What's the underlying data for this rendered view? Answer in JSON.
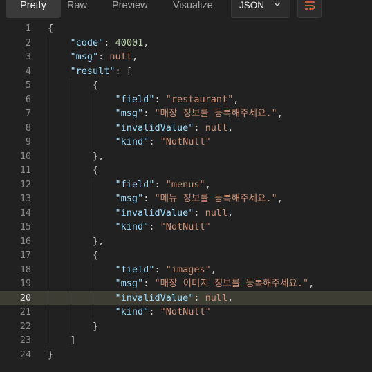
{
  "tabs": [
    {
      "label": "Pretty"
    },
    {
      "label": "Raw"
    },
    {
      "label": "Preview"
    },
    {
      "label": "Visualize"
    }
  ],
  "format_select": {
    "value": "JSON"
  },
  "wrap_button": {
    "icon": "wrap-lines-icon"
  },
  "highlighted_line": 20,
  "lines": [
    {
      "n": "1",
      "indent": 0,
      "tokens": [
        [
          "p",
          "{"
        ]
      ]
    },
    {
      "n": "2",
      "indent": 1,
      "tokens": [
        [
          "k",
          "\"code\""
        ],
        [
          "p",
          ": "
        ],
        [
          "n",
          "40001"
        ],
        [
          "p",
          ","
        ]
      ]
    },
    {
      "n": "3",
      "indent": 1,
      "tokens": [
        [
          "k",
          "\"msg\""
        ],
        [
          "p",
          ": "
        ],
        [
          "nl",
          "null"
        ],
        [
          "p",
          ","
        ]
      ]
    },
    {
      "n": "4",
      "indent": 1,
      "tokens": [
        [
          "k",
          "\"result\""
        ],
        [
          "p",
          ": ["
        ]
      ]
    },
    {
      "n": "5",
      "indent": 2,
      "tokens": [
        [
          "p",
          "{"
        ]
      ]
    },
    {
      "n": "6",
      "indent": 3,
      "tokens": [
        [
          "k",
          "\"field\""
        ],
        [
          "p",
          ": "
        ],
        [
          "s",
          "\"restaurant\""
        ],
        [
          "p",
          ","
        ]
      ]
    },
    {
      "n": "7",
      "indent": 3,
      "tokens": [
        [
          "k",
          "\"msg\""
        ],
        [
          "p",
          ": "
        ],
        [
          "s",
          "\"매장 정보를 등록해주세요.\""
        ],
        [
          "p",
          ","
        ]
      ]
    },
    {
      "n": "8",
      "indent": 3,
      "tokens": [
        [
          "k",
          "\"invalidValue\""
        ],
        [
          "p",
          ": "
        ],
        [
          "nl",
          "null"
        ],
        [
          "p",
          ","
        ]
      ]
    },
    {
      "n": "9",
      "indent": 3,
      "tokens": [
        [
          "k",
          "\"kind\""
        ],
        [
          "p",
          ": "
        ],
        [
          "s",
          "\"NotNull\""
        ]
      ]
    },
    {
      "n": "10",
      "indent": 2,
      "tokens": [
        [
          "p",
          "},"
        ]
      ]
    },
    {
      "n": "11",
      "indent": 2,
      "tokens": [
        [
          "p",
          "{"
        ]
      ]
    },
    {
      "n": "12",
      "indent": 3,
      "tokens": [
        [
          "k",
          "\"field\""
        ],
        [
          "p",
          ": "
        ],
        [
          "s",
          "\"menus\""
        ],
        [
          "p",
          ","
        ]
      ]
    },
    {
      "n": "13",
      "indent": 3,
      "tokens": [
        [
          "k",
          "\"msg\""
        ],
        [
          "p",
          ": "
        ],
        [
          "s",
          "\"메뉴 정보를 등록해주세요.\""
        ],
        [
          "p",
          ","
        ]
      ]
    },
    {
      "n": "14",
      "indent": 3,
      "tokens": [
        [
          "k",
          "\"invalidValue\""
        ],
        [
          "p",
          ": "
        ],
        [
          "nl",
          "null"
        ],
        [
          "p",
          ","
        ]
      ]
    },
    {
      "n": "15",
      "indent": 3,
      "tokens": [
        [
          "k",
          "\"kind\""
        ],
        [
          "p",
          ": "
        ],
        [
          "s",
          "\"NotNull\""
        ]
      ]
    },
    {
      "n": "16",
      "indent": 2,
      "tokens": [
        [
          "p",
          "},"
        ]
      ]
    },
    {
      "n": "17",
      "indent": 2,
      "tokens": [
        [
          "p",
          "{"
        ]
      ]
    },
    {
      "n": "18",
      "indent": 3,
      "tokens": [
        [
          "k",
          "\"field\""
        ],
        [
          "p",
          ": "
        ],
        [
          "s",
          "\"images\""
        ],
        [
          "p",
          ","
        ]
      ]
    },
    {
      "n": "19",
      "indent": 3,
      "tokens": [
        [
          "k",
          "\"msg\""
        ],
        [
          "p",
          ": "
        ],
        [
          "s",
          "\"매장 이미지 정보를 등록해주세요.\""
        ],
        [
          "p",
          ","
        ]
      ]
    },
    {
      "n": "20",
      "indent": 3,
      "tokens": [
        [
          "k",
          "\"invalidValue\""
        ],
        [
          "p",
          ": "
        ],
        [
          "nl",
          "null"
        ],
        [
          "p",
          ","
        ]
      ]
    },
    {
      "n": "21",
      "indent": 3,
      "tokens": [
        [
          "k",
          "\"kind\""
        ],
        [
          "p",
          ": "
        ],
        [
          "s",
          "\"NotNull\""
        ]
      ]
    },
    {
      "n": "22",
      "indent": 2,
      "tokens": [
        [
          "p",
          "}"
        ]
      ]
    },
    {
      "n": "23",
      "indent": 1,
      "tokens": [
        [
          "p",
          "]"
        ]
      ]
    },
    {
      "n": "24",
      "indent": 0,
      "tokens": [
        [
          "p",
          "}"
        ]
      ]
    }
  ]
}
